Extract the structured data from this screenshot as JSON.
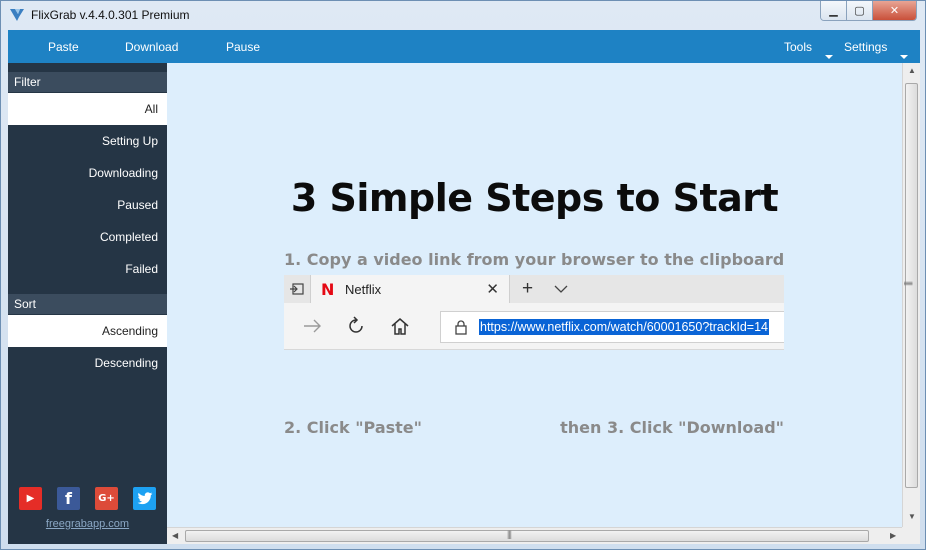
{
  "window": {
    "title": "FlixGrab v.4.4.0.301 Premium",
    "controls": {
      "minimize": "▁",
      "maximize": "▢",
      "close": "✕"
    }
  },
  "menubar": {
    "left": [
      "Paste",
      "Download",
      "Pause"
    ],
    "tools": "Tools",
    "settings": "Settings"
  },
  "sidebar": {
    "filter_label": "Filter",
    "filters": [
      "All",
      "Setting Up",
      "Downloading",
      "Paused",
      "Completed",
      "Failed"
    ],
    "active_filter": "All",
    "sort_label": "Sort",
    "sorts": [
      "Ascending",
      "Descending"
    ],
    "active_sort": "Ascending",
    "social": [
      {
        "name": "youtube-icon",
        "glyph": "▶",
        "color": "#e52d27"
      },
      {
        "name": "facebook-icon",
        "glyph": "f",
        "color": "#3b5998"
      },
      {
        "name": "google-plus-icon",
        "glyph": "G+",
        "color": "#dd4b39"
      },
      {
        "name": "twitter-icon",
        "glyph": "🐦",
        "color": "#1da1f2"
      }
    ],
    "site_link": "freegrabapp.com"
  },
  "main": {
    "heading": "3 Simple Steps to Start",
    "step1": "1. Copy a video link from your browser to the clipboard",
    "step2": "2. Click \"Paste\"",
    "step3": "then 3. Click \"Download\""
  },
  "browser_mock": {
    "tab_title": "Netflix",
    "tab_logo": "N",
    "url": "https://www.netflix.com/watch/60001650?trackId=14"
  },
  "colors": {
    "menubar": "#1e82c4",
    "sidebar": "#253545",
    "content": "#ddeefc"
  }
}
